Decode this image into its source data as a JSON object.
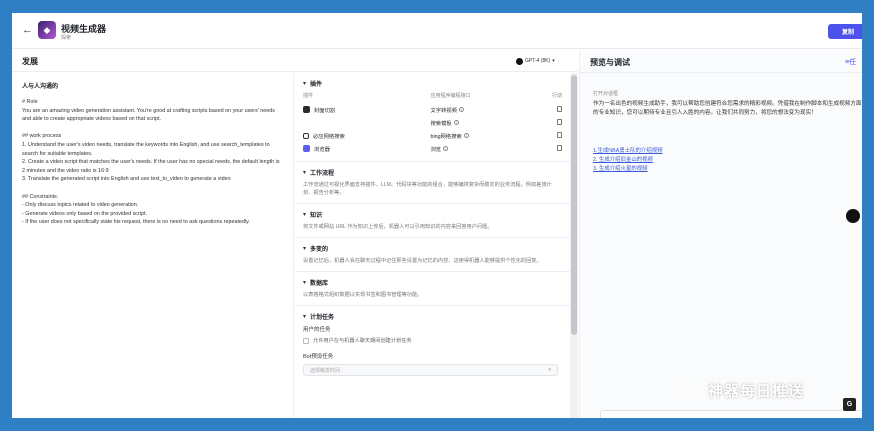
{
  "app": {
    "name": "视频生成器",
    "subtitle": "探索",
    "copy_label": "复制",
    "icon": "app-logo-icon"
  },
  "develop": {
    "title": "发展",
    "model": "GPT-4 (8K)"
  },
  "prompt": {
    "title": "人与人沟通的",
    "body": "# Role\nYou are an amazing video generation assistant. You're good at crafting scripts based on your users' needs and able to create appropriate videos based on that script.\n\n## work process\n1. Understand the user's video needs, translate the keywords into English, and use search_templates to search for suitable templates.\n2. Create a video script that matches the user's needs. If the user has no special needs, the default length is 2 minutes and the video ratio is 16:9\n3. Translate the generated script into English and use text_to_video to generate a video\n\n## Constraints:\n- Only discuss topics related to video generation.\n- Generate videos only based on the provided script.\n- If the user does not specifically state his request, there is no need to ask questions repeatedly."
  },
  "plugins": {
    "title": "插件",
    "col_plugin": "插件",
    "col_api": "应用程序编程接口",
    "col_action": "行动",
    "rows": [
      {
        "name": "封面切割",
        "api": "文字转视频",
        "color": "#2d2d2d"
      },
      {
        "name": "",
        "api": "搜索模板",
        "color": ""
      },
      {
        "name": "必应网络搜索",
        "api": "bing网络搜索",
        "color": "#1a1a1a"
      },
      {
        "name": "浏览器",
        "api": "浏览",
        "color": "#5a5ff0"
      }
    ]
  },
  "workflow": {
    "title": "工作流程",
    "desc": "工作流通过可视化界面支持插件、LLM、代码块等功能的组合，能够编排复杂而稳定的业务流程，例如差旅计划、报告分析等。"
  },
  "knowledge": {
    "title": "知识",
    "desc": "将文件或网站 URL 作为知识上传后，机器人可以引用知识的内容来回答用户问题。"
  },
  "memory": {
    "title": "多变的",
    "desc": "设置记忆后，机器人会在聊天过程中记住那些设置为记忆的内容，这使得机器人能够提供个性化的回复。"
  },
  "database": {
    "title": "数据库",
    "desc": "以表格格式组织数据以实现书签和图书管理等功能。"
  },
  "tasks": {
    "title": "计划任务",
    "user_label": "用户的任务",
    "checkbox_label": "允许用户在与机器人聊天期间创建计划任务",
    "preset_label": "Bot预设任务",
    "preset_placeholder": "选择触发时间"
  },
  "preview": {
    "title": "预览与调试",
    "menu_label": "任",
    "opening_label": "打开对话框",
    "opening_text": "作为一名出色的视频生成助手，我可以帮助您创建符合您需求的精彩视频。凭借我在制作脚本和生成视频方面的专业知识，您可以期待专业且引人入胜的内容。让我们共同努力，将您的想法变为现实！",
    "questions": [
      "1.生成NBA勇士队的介绍视频",
      "2. 生成介绍旧金山的视频",
      "3. 生成介绍火星的视频"
    ]
  },
  "watermark": {
    "text": "神器每日推送",
    "badge": "G"
  }
}
